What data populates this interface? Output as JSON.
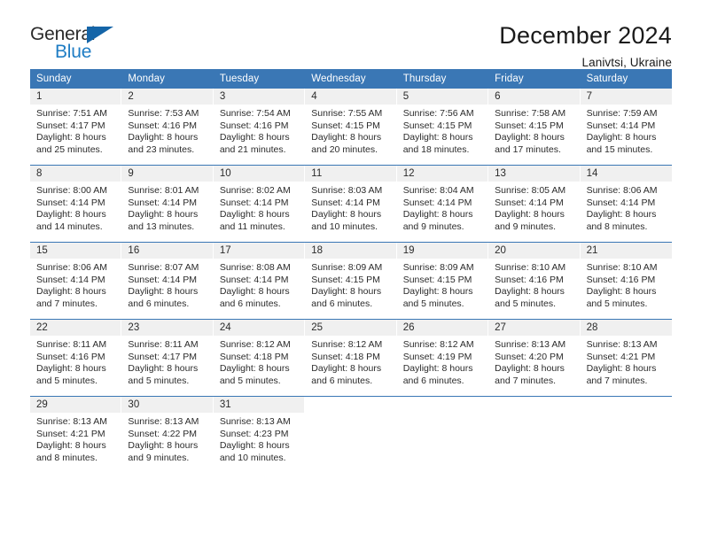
{
  "brand": {
    "name_part1": "General",
    "name_part2": "Blue",
    "triangle_icon": "triangle-icon",
    "colors": {
      "dark": "#2b2b2b",
      "blue": "#1f7dc4",
      "triangle": "#1565a8"
    }
  },
  "header": {
    "title": "December 2024",
    "subtitle": "Lanivtsi, Ukraine"
  },
  "theme": {
    "header_bg": "#3a77b5",
    "day_num_bg": "#f0f0f0",
    "row_border": "#3a77b5",
    "text": "#2b2b2b"
  },
  "weekdays": [
    "Sunday",
    "Monday",
    "Tuesday",
    "Wednesday",
    "Thursday",
    "Friday",
    "Saturday"
  ],
  "weeks": [
    [
      {
        "day": "1",
        "lines": [
          "Sunrise: 7:51 AM",
          "Sunset: 4:17 PM",
          "Daylight: 8 hours",
          "and 25 minutes."
        ]
      },
      {
        "day": "2",
        "lines": [
          "Sunrise: 7:53 AM",
          "Sunset: 4:16 PM",
          "Daylight: 8 hours",
          "and 23 minutes."
        ]
      },
      {
        "day": "3",
        "lines": [
          "Sunrise: 7:54 AM",
          "Sunset: 4:16 PM",
          "Daylight: 8 hours",
          "and 21 minutes."
        ]
      },
      {
        "day": "4",
        "lines": [
          "Sunrise: 7:55 AM",
          "Sunset: 4:15 PM",
          "Daylight: 8 hours",
          "and 20 minutes."
        ]
      },
      {
        "day": "5",
        "lines": [
          "Sunrise: 7:56 AM",
          "Sunset: 4:15 PM",
          "Daylight: 8 hours",
          "and 18 minutes."
        ]
      },
      {
        "day": "6",
        "lines": [
          "Sunrise: 7:58 AM",
          "Sunset: 4:15 PM",
          "Daylight: 8 hours",
          "and 17 minutes."
        ]
      },
      {
        "day": "7",
        "lines": [
          "Sunrise: 7:59 AM",
          "Sunset: 4:14 PM",
          "Daylight: 8 hours",
          "and 15 minutes."
        ]
      }
    ],
    [
      {
        "day": "8",
        "lines": [
          "Sunrise: 8:00 AM",
          "Sunset: 4:14 PM",
          "Daylight: 8 hours",
          "and 14 minutes."
        ]
      },
      {
        "day": "9",
        "lines": [
          "Sunrise: 8:01 AM",
          "Sunset: 4:14 PM",
          "Daylight: 8 hours",
          "and 13 minutes."
        ]
      },
      {
        "day": "10",
        "lines": [
          "Sunrise: 8:02 AM",
          "Sunset: 4:14 PM",
          "Daylight: 8 hours",
          "and 11 minutes."
        ]
      },
      {
        "day": "11",
        "lines": [
          "Sunrise: 8:03 AM",
          "Sunset: 4:14 PM",
          "Daylight: 8 hours",
          "and 10 minutes."
        ]
      },
      {
        "day": "12",
        "lines": [
          "Sunrise: 8:04 AM",
          "Sunset: 4:14 PM",
          "Daylight: 8 hours",
          "and 9 minutes."
        ]
      },
      {
        "day": "13",
        "lines": [
          "Sunrise: 8:05 AM",
          "Sunset: 4:14 PM",
          "Daylight: 8 hours",
          "and 9 minutes."
        ]
      },
      {
        "day": "14",
        "lines": [
          "Sunrise: 8:06 AM",
          "Sunset: 4:14 PM",
          "Daylight: 8 hours",
          "and 8 minutes."
        ]
      }
    ],
    [
      {
        "day": "15",
        "lines": [
          "Sunrise: 8:06 AM",
          "Sunset: 4:14 PM",
          "Daylight: 8 hours",
          "and 7 minutes."
        ]
      },
      {
        "day": "16",
        "lines": [
          "Sunrise: 8:07 AM",
          "Sunset: 4:14 PM",
          "Daylight: 8 hours",
          "and 6 minutes."
        ]
      },
      {
        "day": "17",
        "lines": [
          "Sunrise: 8:08 AM",
          "Sunset: 4:14 PM",
          "Daylight: 8 hours",
          "and 6 minutes."
        ]
      },
      {
        "day": "18",
        "lines": [
          "Sunrise: 8:09 AM",
          "Sunset: 4:15 PM",
          "Daylight: 8 hours",
          "and 6 minutes."
        ]
      },
      {
        "day": "19",
        "lines": [
          "Sunrise: 8:09 AM",
          "Sunset: 4:15 PM",
          "Daylight: 8 hours",
          "and 5 minutes."
        ]
      },
      {
        "day": "20",
        "lines": [
          "Sunrise: 8:10 AM",
          "Sunset: 4:16 PM",
          "Daylight: 8 hours",
          "and 5 minutes."
        ]
      },
      {
        "day": "21",
        "lines": [
          "Sunrise: 8:10 AM",
          "Sunset: 4:16 PM",
          "Daylight: 8 hours",
          "and 5 minutes."
        ]
      }
    ],
    [
      {
        "day": "22",
        "lines": [
          "Sunrise: 8:11 AM",
          "Sunset: 4:16 PM",
          "Daylight: 8 hours",
          "and 5 minutes."
        ]
      },
      {
        "day": "23",
        "lines": [
          "Sunrise: 8:11 AM",
          "Sunset: 4:17 PM",
          "Daylight: 8 hours",
          "and 5 minutes."
        ]
      },
      {
        "day": "24",
        "lines": [
          "Sunrise: 8:12 AM",
          "Sunset: 4:18 PM",
          "Daylight: 8 hours",
          "and 5 minutes."
        ]
      },
      {
        "day": "25",
        "lines": [
          "Sunrise: 8:12 AM",
          "Sunset: 4:18 PM",
          "Daylight: 8 hours",
          "and 6 minutes."
        ]
      },
      {
        "day": "26",
        "lines": [
          "Sunrise: 8:12 AM",
          "Sunset: 4:19 PM",
          "Daylight: 8 hours",
          "and 6 minutes."
        ]
      },
      {
        "day": "27",
        "lines": [
          "Sunrise: 8:13 AM",
          "Sunset: 4:20 PM",
          "Daylight: 8 hours",
          "and 7 minutes."
        ]
      },
      {
        "day": "28",
        "lines": [
          "Sunrise: 8:13 AM",
          "Sunset: 4:21 PM",
          "Daylight: 8 hours",
          "and 7 minutes."
        ]
      }
    ],
    [
      {
        "day": "29",
        "lines": [
          "Sunrise: 8:13 AM",
          "Sunset: 4:21 PM",
          "Daylight: 8 hours",
          "and 8 minutes."
        ]
      },
      {
        "day": "30",
        "lines": [
          "Sunrise: 8:13 AM",
          "Sunset: 4:22 PM",
          "Daylight: 8 hours",
          "and 9 minutes."
        ]
      },
      {
        "day": "31",
        "lines": [
          "Sunrise: 8:13 AM",
          "Sunset: 4:23 PM",
          "Daylight: 8 hours",
          "and 10 minutes."
        ]
      },
      {
        "day": "",
        "lines": []
      },
      {
        "day": "",
        "lines": []
      },
      {
        "day": "",
        "lines": []
      },
      {
        "day": "",
        "lines": []
      }
    ]
  ]
}
